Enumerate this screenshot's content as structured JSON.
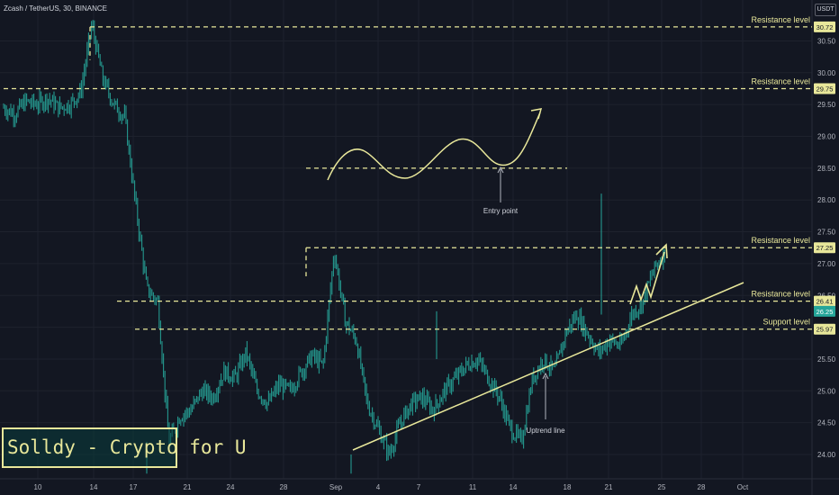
{
  "header": {
    "symbol_line": "Zcash / TetherUS, 30, BINANCE",
    "currency": "USDT"
  },
  "brand": "Solldy - Crypto for U",
  "colors": {
    "background": "#131722",
    "candle": "#26a69a",
    "annotation": "#e8e79a",
    "axis_text": "#b2b5be"
  },
  "chart_data": {
    "type": "line",
    "x_ticks": [
      "10",
      "14",
      "17",
      "21",
      "24",
      "28",
      "Sep",
      "4",
      "7",
      "11",
      "14",
      "18",
      "21",
      "25",
      "28",
      "Oct"
    ],
    "y_ticks": [
      24.0,
      24.5,
      25.0,
      25.5,
      26.0,
      26.5,
      27.0,
      27.5,
      28.0,
      28.5,
      29.0,
      29.5,
      30.0,
      30.5
    ],
    "ylim": [
      23.7,
      31.0
    ],
    "series": [
      {
        "points": [
          29.45,
          29.35,
          29.55,
          29.5,
          29.6,
          29.45,
          29.5,
          29.7,
          30.75,
          29.9,
          29.5,
          29.3,
          27.9,
          26.6,
          26.4,
          24.2,
          24.6,
          24.7,
          25.0,
          24.9,
          25.3,
          25.2,
          25.6,
          25.0,
          24.8,
          25.1,
          25.0,
          25.3,
          25.55,
          25.4,
          27.2,
          26.1,
          25.8,
          24.8,
          24.4,
          24.0,
          24.5,
          24.8,
          24.9,
          24.7,
          25.0,
          25.2,
          25.4,
          25.5,
          25.2,
          24.9,
          24.4,
          24.2,
          25.2,
          25.5,
          25.3,
          25.9,
          26.2,
          25.9,
          25.6,
          25.8,
          25.7,
          26.2,
          26.4,
          26.9,
          27.2
        ]
      }
    ],
    "levels": [
      {
        "label": "Resistance level",
        "value": 30.72,
        "tag": "30.72"
      },
      {
        "label": "Resistance level",
        "value": 29.75,
        "tag": "29.75"
      },
      {
        "label": "Resistance level",
        "value": 27.25,
        "tag": "27.25"
      },
      {
        "label": "Resistance level",
        "value": 26.41,
        "tag": "26.41"
      },
      {
        "label": "Support level",
        "value": 25.97,
        "tag": "25.97"
      }
    ],
    "entry_level": 28.5,
    "current_price": {
      "value": 26.25,
      "tag": "26.25"
    },
    "annotations": {
      "entry": "Entry point",
      "uptrend": "Uptrend line"
    }
  }
}
